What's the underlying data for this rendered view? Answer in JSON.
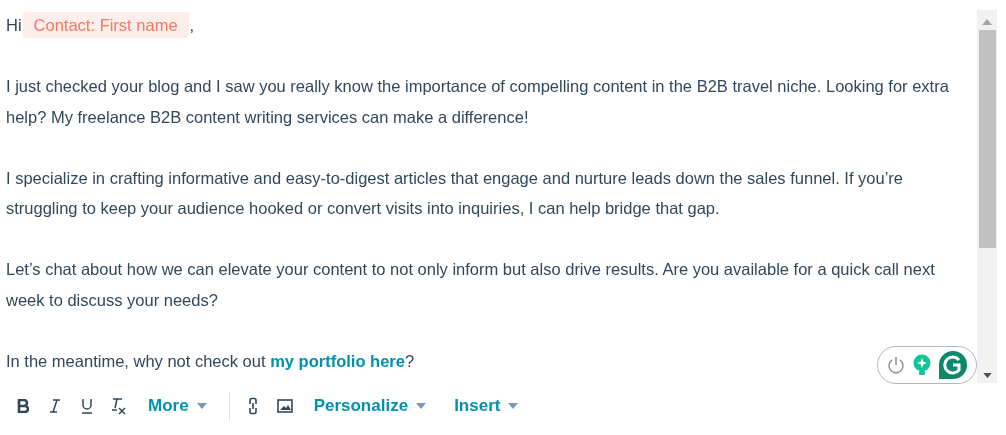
{
  "greeting": {
    "before": "Hi",
    "token": "Contact: First name",
    "after": ","
  },
  "paragraphs": [
    "I just checked your blog and I saw you really know the importance of compelling content in the B2B travel niche. Looking for extra help? My freelance B2B content writing services can make a difference!",
    "I specialize in crafting informative and easy-to-digest articles that engage and nurture leads down the sales funnel. If you’re struggling to keep your audience hooked or convert visits into inquiries, I can help bridge that gap.",
    "Let’s chat about how we can elevate your content to not only inform but also drive results. Are you available for a quick call next week to discuss your needs?"
  ],
  "closing": {
    "before": "In the meantime, why not check out ",
    "link": "my portfolio here",
    "after": "?"
  },
  "toolbar": [
    {
      "kind": "bold"
    },
    {
      "kind": "italic"
    },
    {
      "kind": "underline"
    },
    {
      "kind": "clear"
    },
    {
      "kind": "menu",
      "label": "More"
    },
    {
      "kind": "divider"
    },
    {
      "kind": "link"
    },
    {
      "kind": "image"
    },
    {
      "kind": "menu",
      "label": "Personalize"
    },
    {
      "kind": "menu",
      "label": "Insert"
    }
  ]
}
